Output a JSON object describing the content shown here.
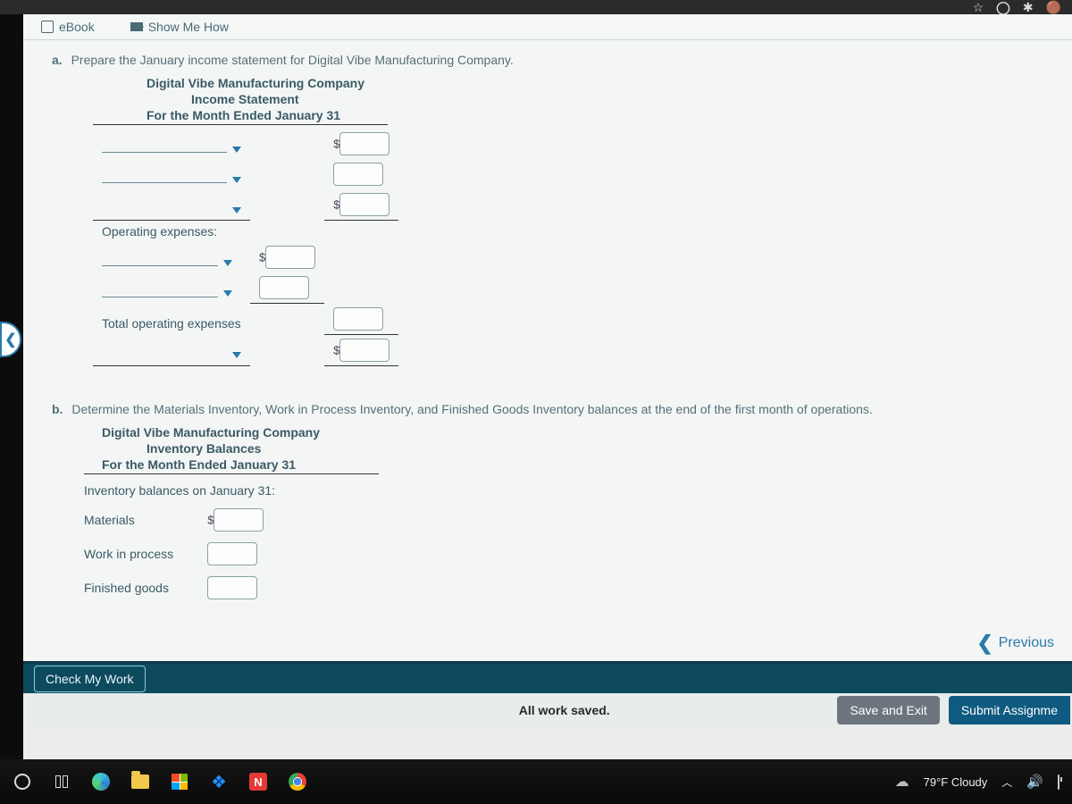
{
  "toolbar": {
    "ebook": "eBook",
    "show": "Show Me How"
  },
  "partA": {
    "letter": "a.",
    "prompt": "Prepare the January income statement for Digital Vibe Manufacturing Company.",
    "company": "Digital Vibe Manufacturing Company",
    "title": "Income Statement",
    "period": "For the Month Ended January 31",
    "operating_label": "Operating expenses:",
    "total_op_label": "Total operating expenses"
  },
  "partB": {
    "letter": "b.",
    "prompt": "Determine the Materials Inventory, Work in Process Inventory, and Finished Goods Inventory balances at the end of the first month of operations.",
    "company": "Digital Vibe Manufacturing Company",
    "title": "Inventory Balances",
    "period": "For the Month Ended January 31",
    "section": "Inventory balances on January 31:",
    "rows": {
      "materials": "Materials",
      "wip": "Work in process",
      "fg": "Finished goods"
    }
  },
  "nav": {
    "previous": "Previous",
    "check": "Check My Work",
    "saved": "All work saved.",
    "save_exit": "Save and Exit",
    "submit": "Submit Assignme"
  },
  "taskbar": {
    "n": "N",
    "weather": "79°F Cloudy"
  },
  "dollar": "$"
}
